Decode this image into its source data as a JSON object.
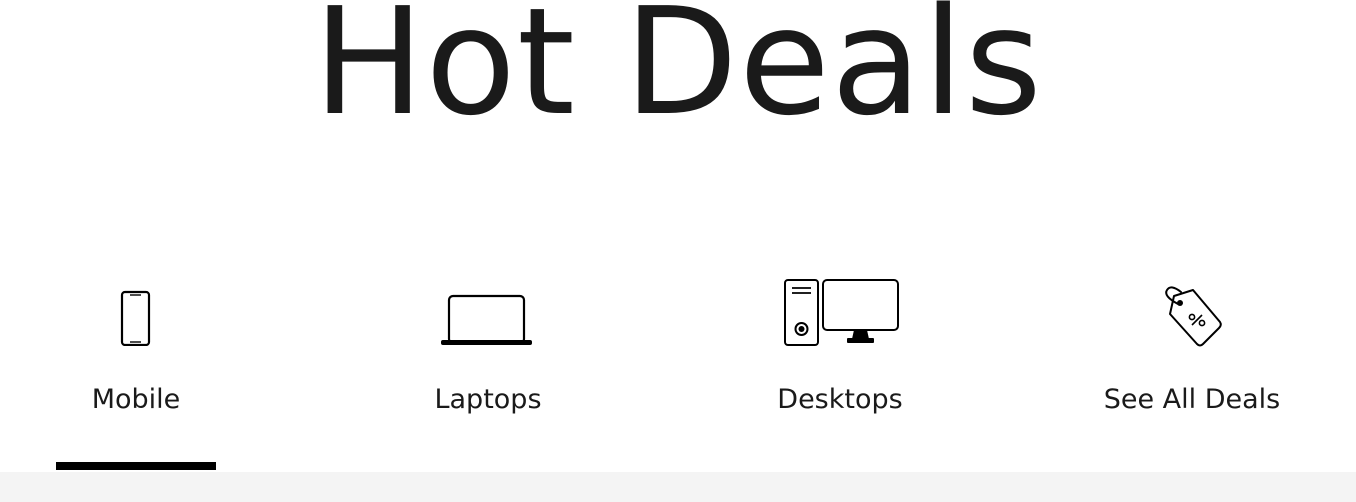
{
  "section": {
    "title": "Hot Deals"
  },
  "tabs": [
    {
      "label": "Mobile",
      "icon": "mobile-phone-icon",
      "selected": true
    },
    {
      "label": "Laptops",
      "icon": "laptop-icon",
      "selected": false
    },
    {
      "label": "Desktops",
      "icon": "desktop-computer-icon",
      "selected": false
    },
    {
      "label": "See All Deals",
      "icon": "price-tag-icon",
      "selected": false
    }
  ],
  "colors": {
    "text": "#1a1a1a",
    "underline": "#000000",
    "footer_band": "#f4f4f4",
    "background": "#ffffff"
  }
}
